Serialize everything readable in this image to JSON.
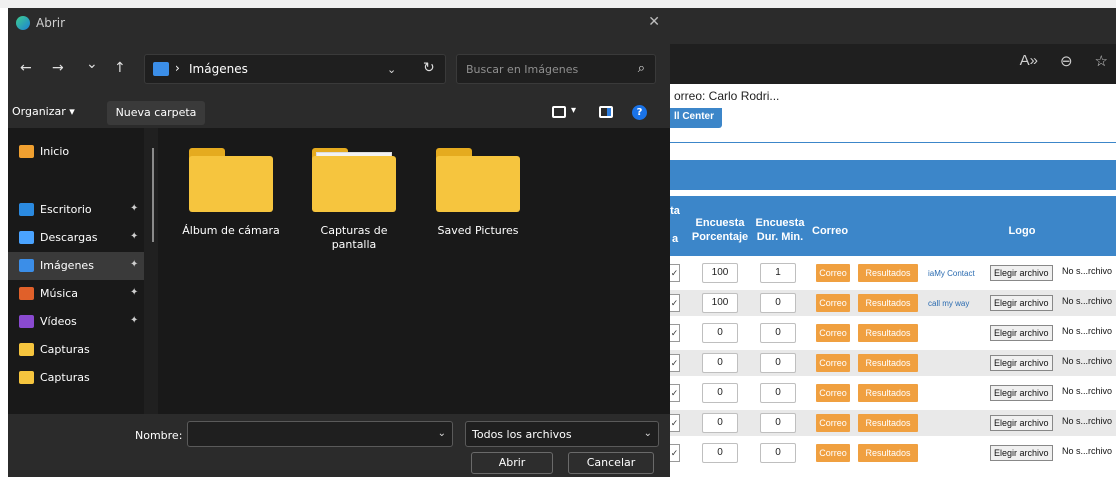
{
  "dialog": {
    "title": "Abrir",
    "close_glyph": "✕",
    "nav": {
      "back": "←",
      "forward": "→",
      "recent": "⌄",
      "up": "↑"
    },
    "address": {
      "separator": "›",
      "path": "Imágenes",
      "dropdown": "⌄",
      "refresh": "↻"
    },
    "search": {
      "placeholder": "Buscar en Imágenes",
      "icon": "⌕"
    },
    "toolbar": {
      "organizar": "Organizar ▾",
      "new_folder": "Nueva carpeta",
      "view_dropdown": "▾",
      "help": "?"
    },
    "sidebar": [
      {
        "label": "Inicio",
        "icon": "home-icon",
        "color": "#f0a030",
        "pinned": false
      },
      {
        "label": "Escritorio",
        "icon": "desktop-icon",
        "color": "#2b8ae0",
        "pinned": true
      },
      {
        "label": "Descargas",
        "icon": "download-icon",
        "color": "#4aa3ff",
        "pinned": true
      },
      {
        "label": "Imágenes",
        "icon": "pictures-icon",
        "color": "#3b8ee8",
        "pinned": true,
        "selected": true
      },
      {
        "label": "Música",
        "icon": "music-icon",
        "color": "#e0602a",
        "pinned": true
      },
      {
        "label": "Vídeos",
        "icon": "videos-icon",
        "color": "#8a4ad0",
        "pinned": true
      },
      {
        "label": "Capturas",
        "icon": "folder-icon",
        "color": "#f6c53e",
        "pinned": false
      },
      {
        "label": "Capturas",
        "icon": "folder-icon",
        "color": "#f6c53e",
        "pinned": false
      }
    ],
    "pin_glyph": "✦",
    "folders": [
      {
        "label": "Álbum de cámara",
        "thumb": false
      },
      {
        "label": "Capturas de pantalla",
        "thumb": true
      },
      {
        "label": "Saved Pictures",
        "thumb": false
      }
    ],
    "bottom": {
      "name_label": "Nombre:",
      "name_value": "",
      "dropdown": "⌄",
      "file_type": "Todos los archivos",
      "open_button": "Abrir",
      "cancel_button": "Cancelar"
    }
  },
  "browser": {
    "icons": [
      "A»",
      "⊖",
      "☆"
    ],
    "email_text": "orreo: Carlo Rodri...",
    "center_button": "ll Center",
    "headers": {
      "ta": "ta",
      "a": "a",
      "encuesta_pct": "Encuesta Porcentaje",
      "encuesta_dur": "Encuesta Dur. Min.",
      "correo": "Correo",
      "logo": "Logo"
    },
    "row_labels": {
      "correo": "Correo",
      "resultados": "Resultados",
      "file_button": "Elegir archivo",
      "file_text_first": "No s...rchivo",
      "file_text": "No s...rchivo"
    },
    "rows": [
      {
        "pct": "100",
        "dur": "1",
        "logo": "iaMy Contact",
        "alt": false
      },
      {
        "pct": "100",
        "dur": "0",
        "logo": "call my way",
        "alt": true
      },
      {
        "pct": "0",
        "dur": "0",
        "logo": "",
        "alt": false
      },
      {
        "pct": "0",
        "dur": "0",
        "logo": "",
        "alt": true
      },
      {
        "pct": "0",
        "dur": "0",
        "logo": "",
        "alt": false
      },
      {
        "pct": "0",
        "dur": "0",
        "logo": "",
        "alt": true
      },
      {
        "pct": "0",
        "dur": "0",
        "logo": "",
        "alt": false
      }
    ],
    "checkmark": "✓",
    "colors": {
      "header_blue": "#3c86c9",
      "orange_button": "#f0a040"
    }
  }
}
